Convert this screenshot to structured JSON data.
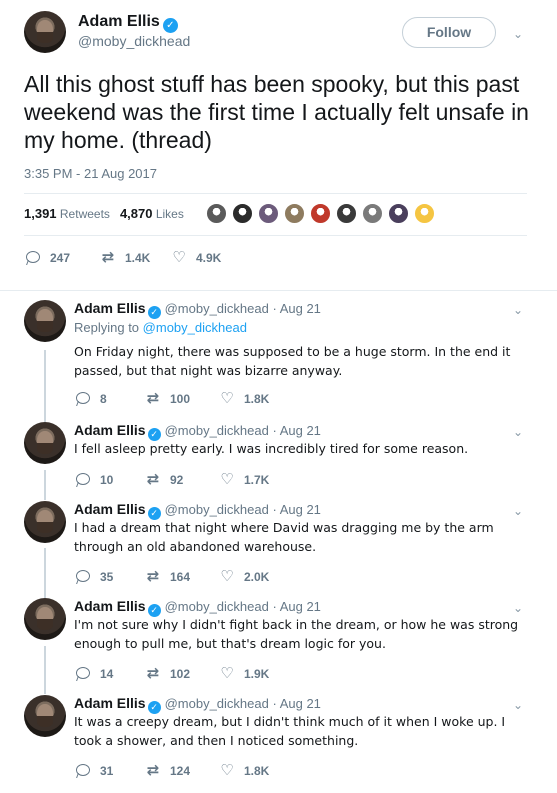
{
  "main_tweet": {
    "author_name": "Adam Ellis",
    "handle": "@moby_dickhead",
    "follow_label": "Follow",
    "text": "All this ghost stuff has been spooky, but this past weekend was the first time I actually felt unsafe in my home. (thread)",
    "timestamp": "3:35 PM - 21 Aug 2017",
    "retweets_count": "1,391",
    "retweets_label": "Retweets",
    "likes_count": "4,870",
    "likes_label": "Likes",
    "liker_avatar_colors": [
      "#5a5a5a",
      "#2b2b2b",
      "#6c5b7b",
      "#8e7b5f",
      "#c0392b",
      "#3a3a3a",
      "#7a7a7a",
      "#4a3f5c",
      "#f5c542"
    ],
    "actions": {
      "replies": "247",
      "retweets": "1.4K",
      "likes": "4.9K"
    }
  },
  "thread": [
    {
      "author_name": "Adam Ellis",
      "handle": "@moby_dickhead",
      "date": "Aug 21",
      "replying_prefix": "Replying to",
      "replying_to": "@moby_dickhead",
      "text": "On Friday night, there was supposed to be a huge storm. In the end it passed, but that night was bizarre anyway.",
      "replies": "8",
      "retweets": "100",
      "likes": "1.8K"
    },
    {
      "author_name": "Adam Ellis",
      "handle": "@moby_dickhead",
      "date": "Aug 21",
      "text": "I fell asleep pretty early. I was incredibly tired for some reason.",
      "replies": "10",
      "retweets": "92",
      "likes": "1.7K"
    },
    {
      "author_name": "Adam Ellis",
      "handle": "@moby_dickhead",
      "date": "Aug 21",
      "text": "I had a dream that night where David was dragging me by the arm through an old abandoned warehouse.",
      "replies": "35",
      "retweets": "164",
      "likes": "2.0K"
    },
    {
      "author_name": "Adam Ellis",
      "handle": "@moby_dickhead",
      "date": "Aug 21",
      "text": "I'm not sure why I didn't fight back in the dream, or how he was strong enough to pull me, but that's dream logic for you.",
      "replies": "14",
      "retweets": "102",
      "likes": "1.9K"
    },
    {
      "author_name": "Adam Ellis",
      "handle": "@moby_dickhead",
      "date": "Aug 21",
      "text": "It was a creepy dream, but I didn't think much of it when I woke up. I took a shower, and then I noticed something.",
      "replies": "31",
      "retweets": "124",
      "likes": "1.8K"
    }
  ],
  "icons": {
    "verified": "✓",
    "chevron": "⌄",
    "retweet": "⇄",
    "like": "♡"
  },
  "colors": {
    "accent": "#1da1f2",
    "muted": "#657786",
    "text": "#14171a",
    "border": "#e6ecf0"
  }
}
